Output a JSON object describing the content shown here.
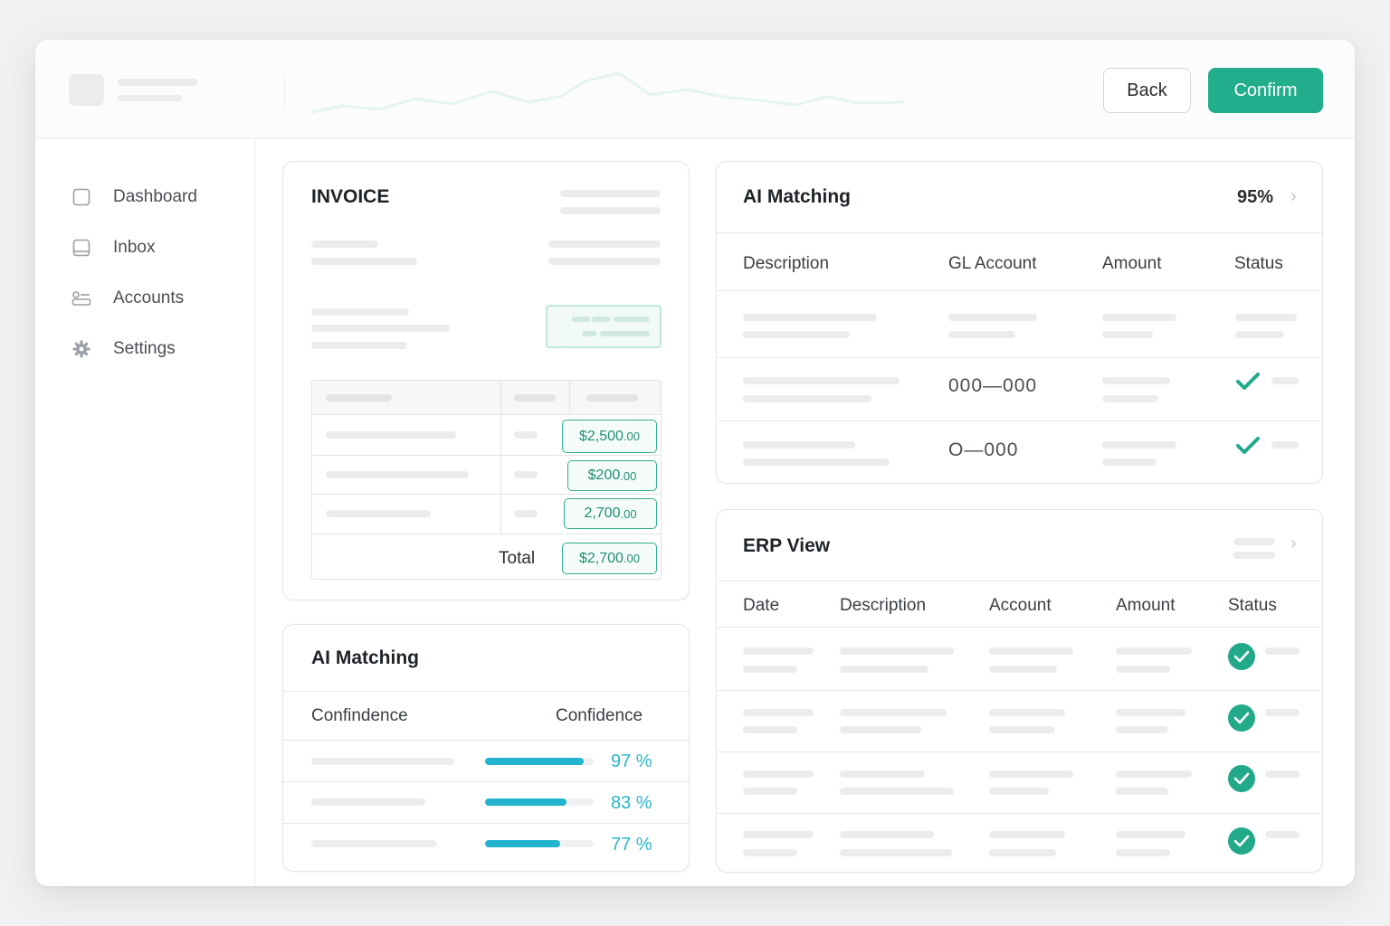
{
  "header": {
    "back_label": "Back",
    "confirm_label": "Confirm",
    "accent_color": "#22ad8c"
  },
  "sidebar": {
    "items": [
      {
        "label": "Dashboard",
        "icon": "square-icon"
      },
      {
        "label": "Inbox",
        "icon": "inbox-icon"
      },
      {
        "label": "Accounts",
        "icon": "accounts-icon"
      },
      {
        "label": "Settings",
        "icon": "gear-icon"
      }
    ]
  },
  "invoice": {
    "title": "INVOICE",
    "amounts": [
      {
        "main": "$2,500",
        "cents": ".00"
      },
      {
        "main": "$200",
        "cents": ".00"
      },
      {
        "main": "2,700",
        "cents": ".00"
      }
    ],
    "total_label": "Total",
    "total": {
      "main": "$2,700",
      "cents": ".00"
    }
  },
  "ai_matching_small": {
    "title": "AI Matching",
    "col1": "Confindence",
    "col2": "Confidence",
    "rows": [
      {
        "percent": "97 %",
        "fill": 0.91
      },
      {
        "percent": "83 %",
        "fill": 0.75
      },
      {
        "percent": "77 %",
        "fill": 0.69
      }
    ],
    "bar_color": "#22b3cf"
  },
  "ai_matching": {
    "title": "AI Matching",
    "score": "95%",
    "columns": [
      "Description",
      "GL Account",
      "Amount",
      "Status"
    ],
    "rows": [
      {
        "gl": "",
        "status": "pending"
      },
      {
        "gl": "000—000",
        "status": "matched"
      },
      {
        "gl": "O—000",
        "status": "matched"
      }
    ]
  },
  "erp_view": {
    "title": "ERP View",
    "columns": [
      "Date",
      "Description",
      "Account",
      "Amount",
      "Status"
    ],
    "rows": [
      {
        "status": "matched"
      },
      {
        "status": "matched"
      },
      {
        "status": "matched"
      },
      {
        "status": "matched"
      }
    ]
  }
}
